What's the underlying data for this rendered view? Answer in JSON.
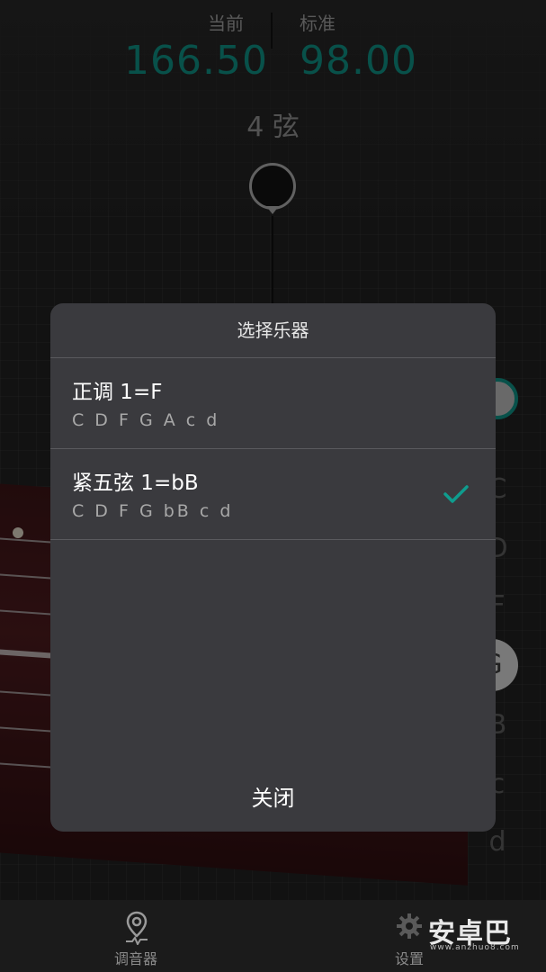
{
  "tuner": {
    "current_label": "当前",
    "standard_label": "标准",
    "current_value": "166.50",
    "standard_value": "98.00",
    "string_name": "4 弦"
  },
  "side_letters": [
    "C",
    "D",
    "F",
    "G",
    "B",
    "c",
    "d"
  ],
  "active_letter_index": 3,
  "dialog": {
    "title": "选择乐器",
    "options": [
      {
        "name": "正调 1=F",
        "notes": "C D F G A c d",
        "selected": false
      },
      {
        "name": "紧五弦 1=bB",
        "notes": "C D F G bB c d",
        "selected": true
      }
    ],
    "close_label": "关闭"
  },
  "bottom_bar": {
    "tabs": [
      {
        "label": "调音器",
        "icon": "location-pin-pulse-icon"
      },
      {
        "label": "设置",
        "icon": "gear-icon"
      }
    ]
  },
  "watermark": {
    "text": "安卓巴",
    "sub": "www.anzhuo8.com"
  },
  "colors": {
    "accent": "#0f8c80",
    "dialog_bg": "#3a3a3e",
    "background": "#202020"
  }
}
